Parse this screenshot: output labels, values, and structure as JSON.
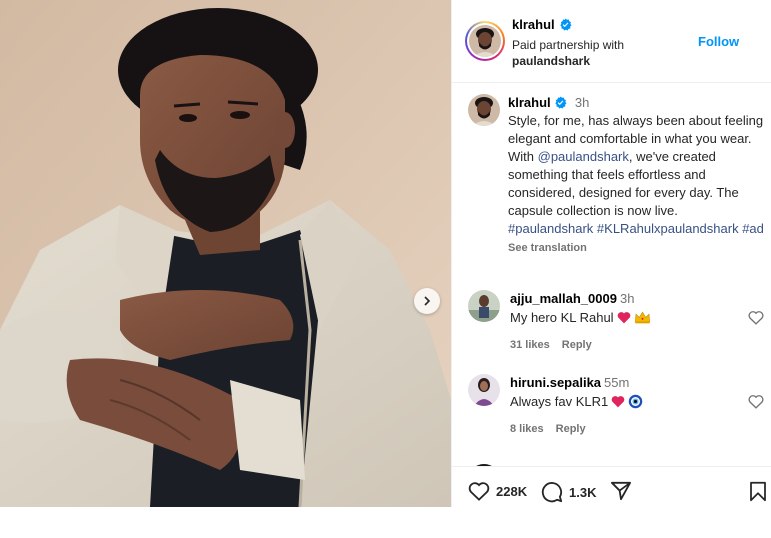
{
  "header": {
    "username": "klrahul",
    "subtitle": "Paid partnership with",
    "partner": "paulandshark",
    "follow_label": "Follow"
  },
  "caption": {
    "username": "klrahul",
    "time": "3h",
    "text_1": "Style, for me, has always been about feeling elegant and comfortable in what you wear. With ",
    "mention": "@paulandshark",
    "text_2": ", we've created something that feels effortless and considered, designed for every day. The capsule collection is now live. ",
    "hashtag_1": "#paulandshark",
    "hashtag_2": "#KLRahulxpaulandshark",
    "hashtag_3": "#ad",
    "see_translation": "See translation"
  },
  "comments": [
    {
      "username": "ajju_mallah_0009",
      "time": "3h",
      "text": "My hero KL Rahul",
      "likes": "31 likes",
      "reply": "Reply"
    },
    {
      "username": "hiruni.sepalika",
      "time": "55m",
      "text": "Always fav KLR1",
      "likes": "8 likes",
      "reply": "Reply"
    }
  ],
  "actions": {
    "likes_count": "228K",
    "comments_count": "1.3K"
  },
  "colors": {
    "link": "#0095f6",
    "hashtag": "#385185",
    "verified": "#0095f6",
    "muted": "#737373"
  }
}
